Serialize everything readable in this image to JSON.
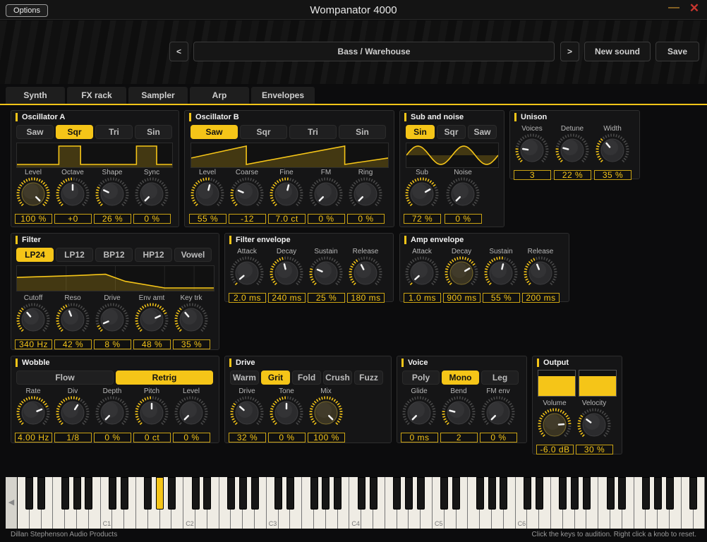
{
  "window": {
    "title": "Wompanator 4000",
    "options": "Options",
    "minimize": "—",
    "close": "✕"
  },
  "header": {
    "prev": "<",
    "next": ">",
    "preset": "Bass  /  Warehouse",
    "new_sound": "New sound",
    "save": "Save"
  },
  "tabs": [
    {
      "label": "Synth",
      "active": true
    },
    {
      "label": "FX rack",
      "active": false
    },
    {
      "label": "Sampler",
      "active": false
    },
    {
      "label": "Arp",
      "active": false
    },
    {
      "label": "Envelopes",
      "active": false
    }
  ],
  "osc_a": {
    "title": "Oscillator A",
    "waves": [
      "Saw",
      "Sqr",
      "Tri",
      "Sin"
    ],
    "selected": 1,
    "knobs": [
      {
        "label": "Level",
        "value": "100 %",
        "amount": 1.0,
        "highlight": true
      },
      {
        "label": "Octave",
        "value": "+0",
        "amount": 0.5
      },
      {
        "label": "Shape",
        "value": "26 %",
        "amount": 0.26
      },
      {
        "label": "Sync",
        "value": "0 %",
        "amount": 0.0
      }
    ]
  },
  "osc_b": {
    "title": "Oscillator B",
    "waves": [
      "Saw",
      "Sqr",
      "Tri",
      "Sin"
    ],
    "selected": 0,
    "knobs": [
      {
        "label": "Level",
        "value": "55 %",
        "amount": 0.55
      },
      {
        "label": "Coarse",
        "value": "-12",
        "amount": 0.25
      },
      {
        "label": "Fine",
        "value": "7.0 ct",
        "amount": 0.55
      },
      {
        "label": "FM",
        "value": "0 %",
        "amount": 0.0
      },
      {
        "label": "Ring",
        "value": "0 %",
        "amount": 0.0
      }
    ]
  },
  "sub": {
    "title": "Sub and noise",
    "waves": [
      "Sin",
      "Sqr",
      "Saw"
    ],
    "selected": 0,
    "knobs": [
      {
        "label": "Sub",
        "value": "72 %",
        "amount": 0.72
      },
      {
        "label": "Noise",
        "value": "0 %",
        "amount": 0.0
      }
    ]
  },
  "unison": {
    "title": "Unison",
    "knobs": [
      {
        "label": "Voices",
        "value": "3",
        "amount": 0.2
      },
      {
        "label": "Detune",
        "value": "22 %",
        "amount": 0.22
      },
      {
        "label": "Width",
        "value": "35 %",
        "amount": 0.35
      }
    ]
  },
  "filter": {
    "title": "Filter",
    "modes": [
      "LP24",
      "LP12",
      "BP12",
      "HP12",
      "Vowel"
    ],
    "selected": 0,
    "knobs": [
      {
        "label": "Cutoff",
        "value": "340 Hz",
        "amount": 0.35
      },
      {
        "label": "Reso",
        "value": "42 %",
        "amount": 0.42
      },
      {
        "label": "Drive",
        "value": "8 %",
        "amount": 0.08
      },
      {
        "label": "Env amt",
        "value": "48 %",
        "amount": 0.74
      },
      {
        "label": "Key trk",
        "value": "35 %",
        "amount": 0.35
      }
    ]
  },
  "filter_env": {
    "title": "Filter envelope",
    "knobs": [
      {
        "label": "Attack",
        "value": "2.0 ms",
        "amount": 0.02
      },
      {
        "label": "Decay",
        "value": "240 ms",
        "amount": 0.45
      },
      {
        "label": "Sustain",
        "value": "25 %",
        "amount": 0.25
      },
      {
        "label": "Release",
        "value": "180 ms",
        "amount": 0.4
      }
    ]
  },
  "amp_env": {
    "title": "Amp envelope",
    "knobs": [
      {
        "label": "Attack",
        "value": "1.0 ms",
        "amount": 0.01
      },
      {
        "label": "Decay",
        "value": "900 ms",
        "amount": 0.72,
        "highlight": true
      },
      {
        "label": "Sustain",
        "value": "55 %",
        "amount": 0.55
      },
      {
        "label": "Release",
        "value": "200 ms",
        "amount": 0.42
      }
    ]
  },
  "wobble": {
    "title": "Wobble",
    "modes": [
      "Flow",
      "Retrig"
    ],
    "selected": 1,
    "knobs": [
      {
        "label": "Rate",
        "value": "4.00 Hz",
        "amount": 0.75
      },
      {
        "label": "Div",
        "value": "1/8",
        "amount": 0.62
      },
      {
        "label": "Depth",
        "value": "0 %",
        "amount": 0.0
      },
      {
        "label": "Pitch",
        "value": "0 ct",
        "amount": 0.5
      },
      {
        "label": "Level",
        "value": "0 %",
        "amount": 0.0
      }
    ]
  },
  "drive": {
    "title": "Drive",
    "modes": [
      "Warm",
      "Grit",
      "Fold",
      "Crush",
      "Fuzz"
    ],
    "selected": 1,
    "knobs": [
      {
        "label": "Drive",
        "value": "32 %",
        "amount": 0.32
      },
      {
        "label": "Tone",
        "value": "0 %",
        "amount": 0.5
      },
      {
        "label": "Mix",
        "value": "100 %",
        "amount": 1.0,
        "highlight": true
      }
    ]
  },
  "voice": {
    "title": "Voice",
    "modes": [
      "Poly",
      "Mono",
      "Leg"
    ],
    "selected": 1,
    "knobs": [
      {
        "label": "Glide",
        "value": "0 ms",
        "amount": 0.0
      },
      {
        "label": "Bend",
        "value": "2",
        "amount": 0.22
      },
      {
        "label": "FM env",
        "value": "0 %",
        "amount": 0.0
      }
    ]
  },
  "output": {
    "title": "Output",
    "meters": [
      0.78,
      0.78
    ],
    "knobs": [
      {
        "label": "Volume",
        "value": "-6.0 dB",
        "amount": 0.82,
        "highlight": true
      },
      {
        "label": "Velocity",
        "value": "30 %",
        "amount": 0.3
      }
    ]
  },
  "keyboard": {
    "notes": [
      "C1",
      "C2",
      "C3",
      "C4",
      "C5",
      "C6"
    ],
    "scroll": "◀"
  },
  "footer": {
    "left": "Dillan Stephenson Audio Products",
    "right": "Click the keys to audition. Right click a knob to reset."
  },
  "colors": {
    "accent": "#f5c518",
    "panel": "#151516",
    "background": "#0c0c0d"
  }
}
